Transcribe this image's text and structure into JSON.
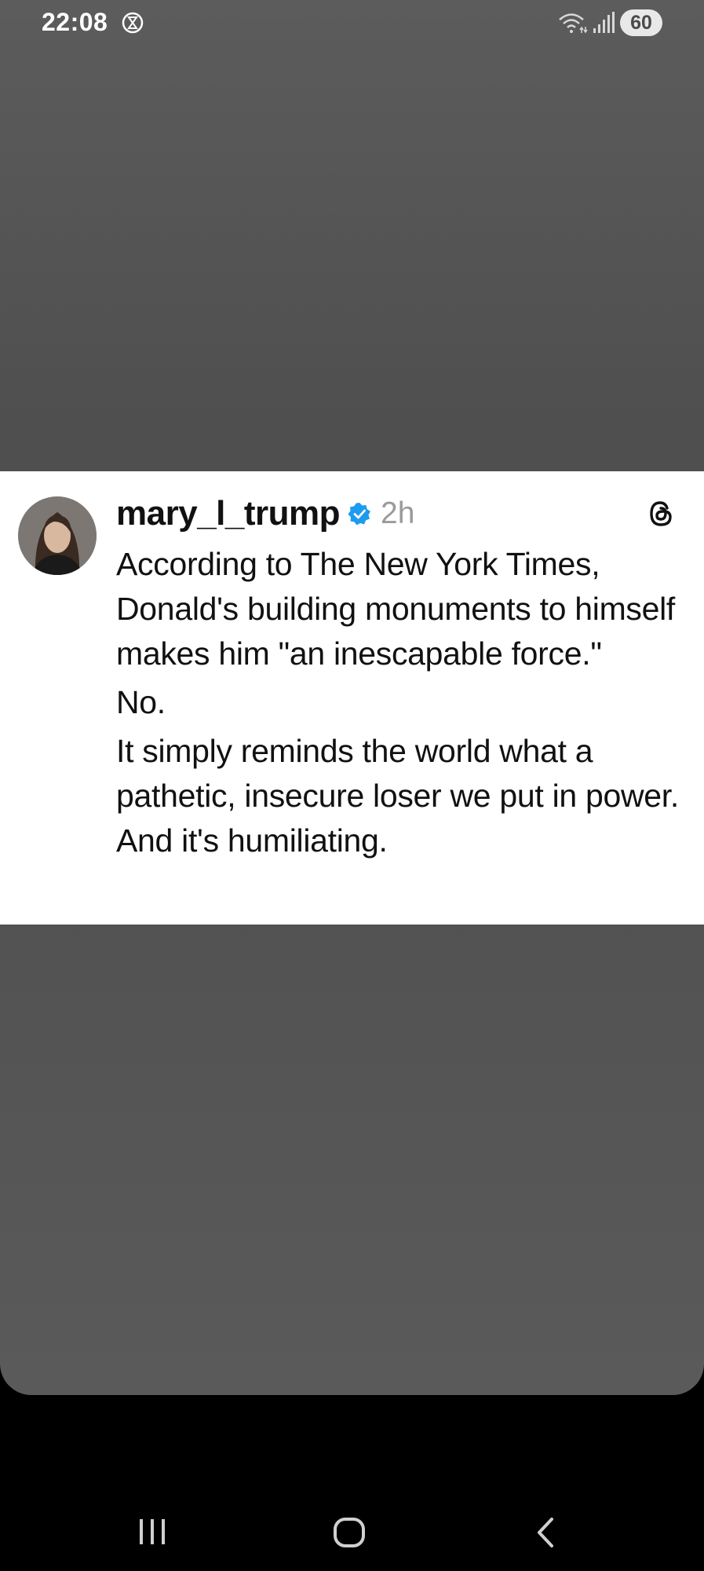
{
  "status_bar": {
    "time": "22:08",
    "battery": "60",
    "icons": [
      "timer-icon",
      "wifi-icon",
      "signal-icon"
    ]
  },
  "post": {
    "username": "mary_l_trump",
    "verified": true,
    "time": "2h",
    "paragraphs": [
      "According to The New York Times, Donald's building monuments to himself makes him \"an inescapable force.\"",
      "No.",
      "It simply reminds the world what a pathetic, insecure loser we put in power. And it's humiliating."
    ],
    "colors": {
      "verified": "#1d9bf0",
      "text": "#111111",
      "meta": "#9a9a9a"
    }
  },
  "nav": {
    "icons": [
      "recent-apps-icon",
      "home-icon",
      "back-icon"
    ]
  }
}
